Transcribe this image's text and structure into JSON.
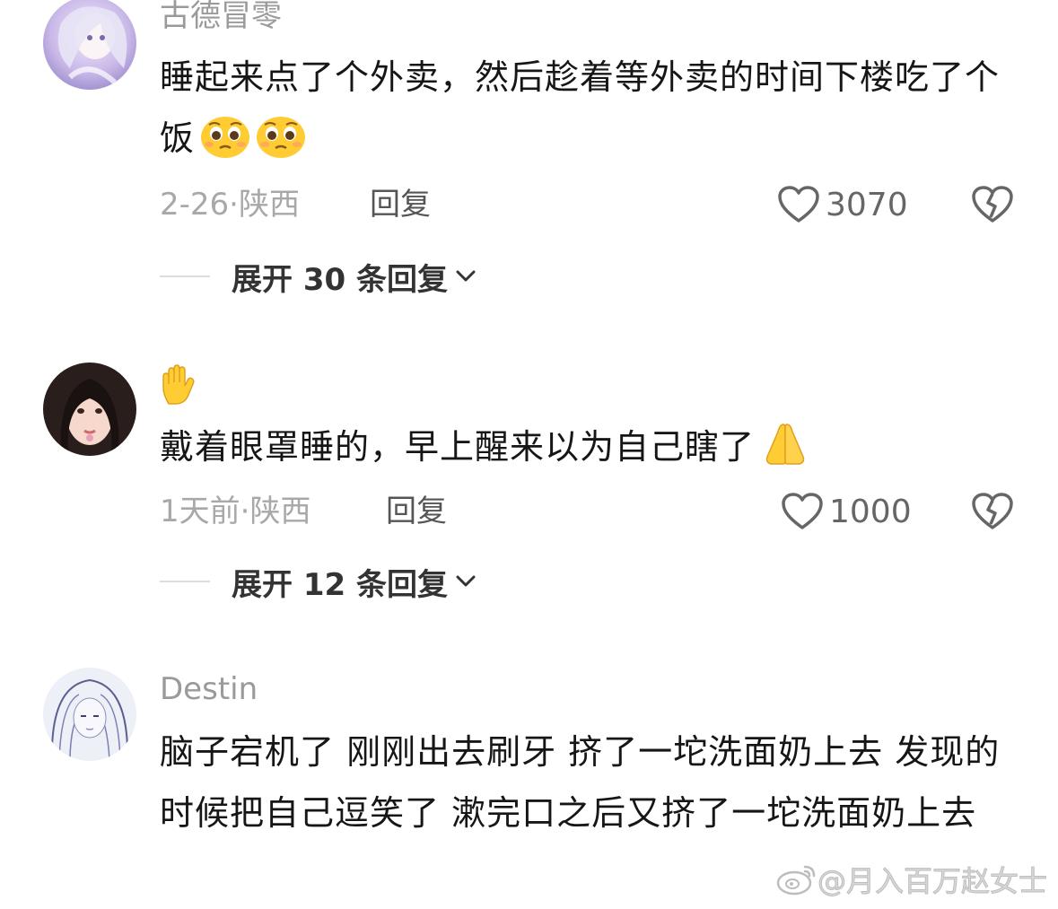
{
  "comments": [
    {
      "username": "古德冒零",
      "text": "睡起来点了个外卖，然后趁着等外卖的时间下楼吃了个饭",
      "emojis": [
        "pleading-face-icon",
        "pleading-face-icon"
      ],
      "time": "2-26",
      "location": "陕西",
      "reply_label": "回复",
      "likes": "3070",
      "expand_label": "展开 30 条回复"
    },
    {
      "username_emoji": "raised-hand-icon",
      "text": "戴着眼罩睡的，早上醒来以为自己瞎了",
      "emojis": [
        "praying-hands-icon"
      ],
      "time": "1天前",
      "location": "陕西",
      "reply_label": "回复",
      "likes": "1000",
      "expand_label": "展开 12 条回复"
    },
    {
      "username": "Destin",
      "text": "脑子宕机了 刚刚出去刷牙 挤了一坨洗面奶上去 发现的时候把自己逗笑了 漱完口之后又挤了一坨洗面奶上去"
    }
  ],
  "meta_separator": "·",
  "watermark": "@月入百万赵女士",
  "colors": {
    "username": "#9a9a9a",
    "text": "#161616",
    "meta": "#a8a8a8",
    "emoji_yellow": "#ffcc33"
  }
}
